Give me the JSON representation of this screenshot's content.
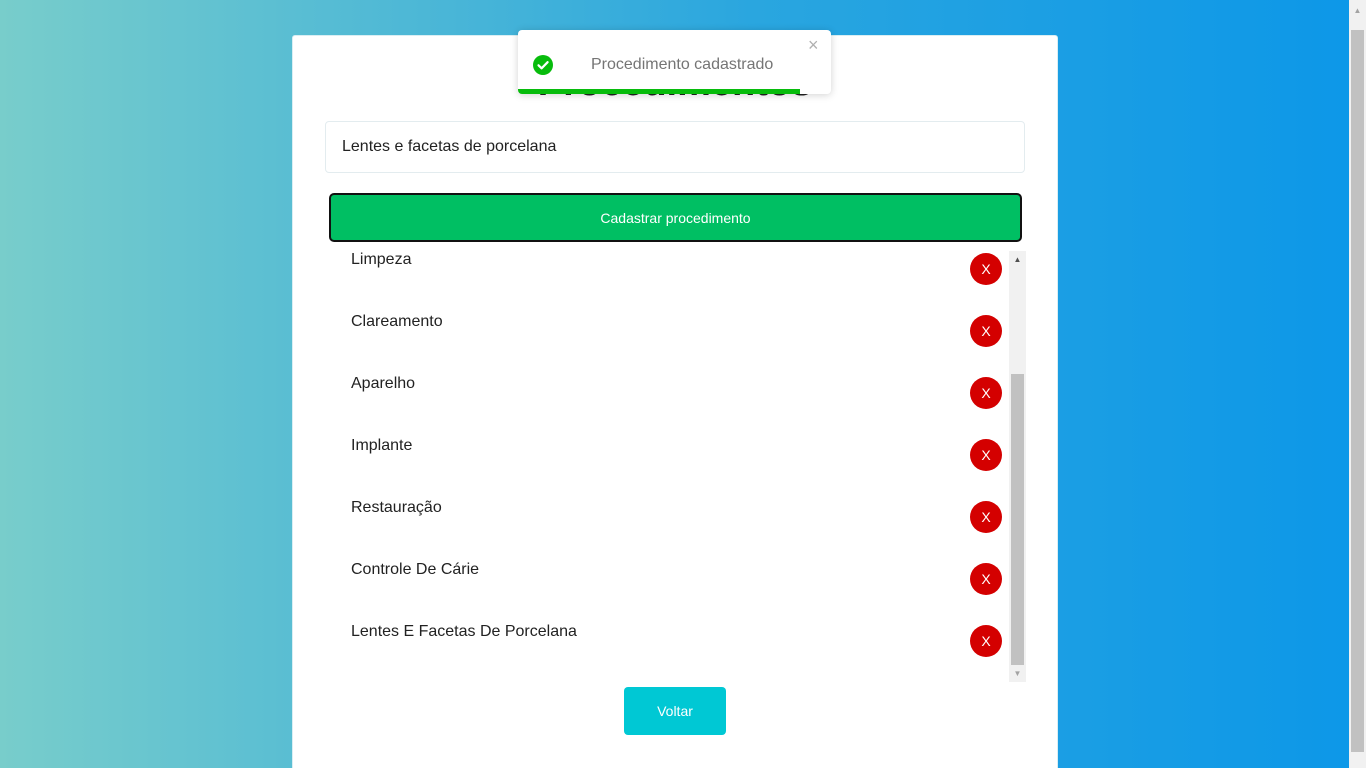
{
  "page": {
    "title": "Procedimentos"
  },
  "form": {
    "input_value": "Lentes e facetas de porcelana",
    "submit_label": "Cadastrar procedimento"
  },
  "procedures": [
    {
      "label": "Limpeza",
      "delete_label": "X"
    },
    {
      "label": "Clareamento",
      "delete_label": "X"
    },
    {
      "label": "Aparelho",
      "delete_label": "X"
    },
    {
      "label": "Implante",
      "delete_label": "X"
    },
    {
      "label": "Restauração",
      "delete_label": "X"
    },
    {
      "label": "Controle De Cárie",
      "delete_label": "X"
    },
    {
      "label": "Lentes E Facetas De Porcelana",
      "delete_label": "X"
    }
  ],
  "back_button": {
    "label": "Voltar"
  },
  "toast": {
    "message": "Procedimento cadastrado",
    "close_glyph": "×",
    "icon": "check-circle-icon",
    "progress": 0.9
  },
  "colors": {
    "success": "#00bf63",
    "toast_success": "#07bc0c",
    "delete": "#d40000",
    "back": "#00c8d4"
  }
}
